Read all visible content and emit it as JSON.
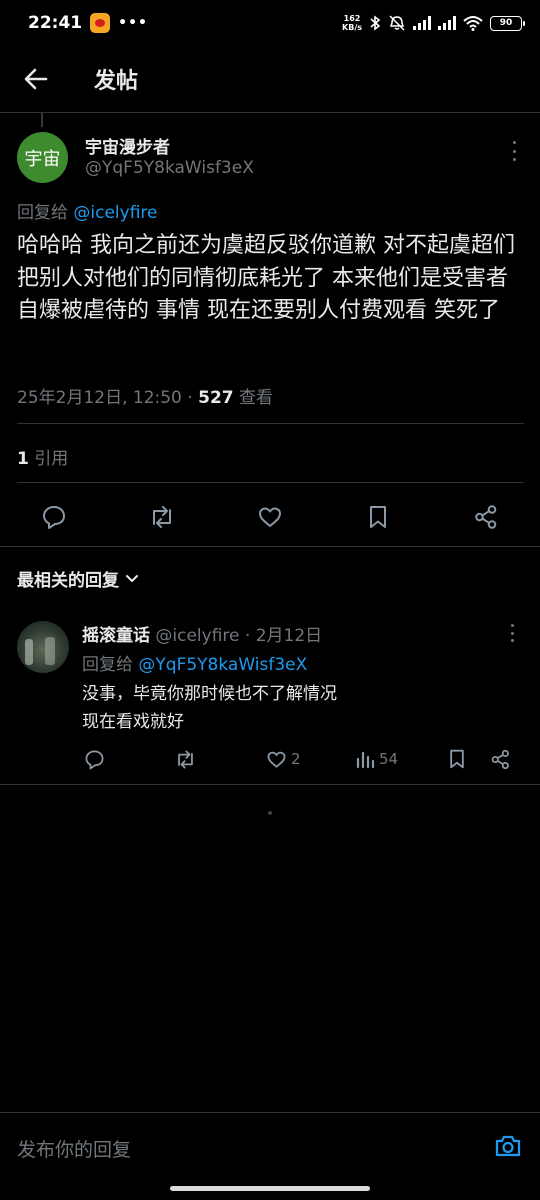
{
  "status_bar": {
    "time": "22:41",
    "net_speed_value": "162",
    "net_speed_unit": "KB/s",
    "battery": "90"
  },
  "header": {
    "title": "发帖"
  },
  "post": {
    "avatar_text": "宇宙",
    "avatar_color": "#3e8a2f",
    "display_name": "宇宙漫步者",
    "handle": "@YqF5Y8kaWisf3eX",
    "reply_to_prefix": "回复给 ",
    "reply_to_handle": "@icelyfire",
    "text": "哈哈哈 我向之前还为虞超反驳你道歉 对不起虞超们把别人对他们的同情彻底耗光了 本来他们是受害者 自爆被虐待的 事情 现在还要别人付费观看 笑死了",
    "timestamp": "25年2月12日, 12:50",
    "separator": " · ",
    "views_count": "527",
    "views_label": " 查看",
    "quote_count": "1",
    "quote_label": " 引用"
  },
  "sort": {
    "label": "最相关的回复"
  },
  "reply": {
    "display_name": "摇滚童话",
    "handle": " @icelyfire",
    "dot": " · ",
    "date": "2月12日",
    "reply_to_prefix": "回复给 ",
    "reply_to_handle": "@YqF5Y8kaWisf3eX",
    "text_line1": "没事，毕竟你那时候也不了解情况",
    "text_line2": "现在看戏就好",
    "likes": "2",
    "views": "54"
  },
  "compose": {
    "placeholder": "发布你的回复"
  },
  "colors": {
    "background": "#000000",
    "text_primary": "#e7e9ea",
    "text_secondary": "#71767b",
    "accent": "#1d9bf0",
    "divider": "#2f3336"
  }
}
